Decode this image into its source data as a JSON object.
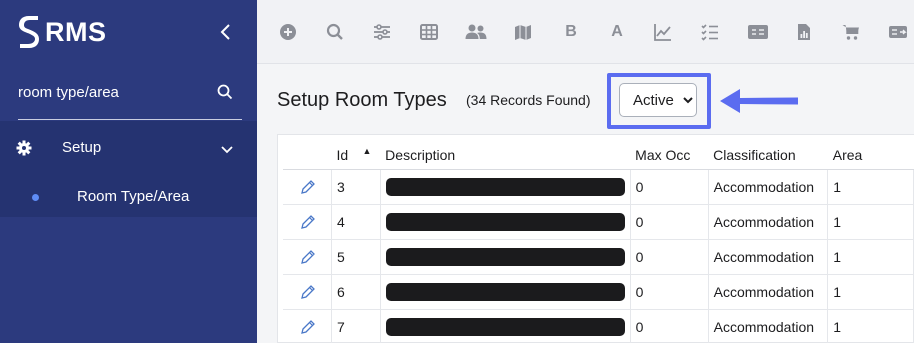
{
  "app": {
    "logo_text": "RMS"
  },
  "sidebar": {
    "search": {
      "value": "room type/area",
      "placeholder": ""
    },
    "menu": {
      "label": "Setup",
      "icon": "gear-icon",
      "expanded": true,
      "items": [
        {
          "label": "Room Type/Area",
          "active": true
        }
      ]
    }
  },
  "toolbar": {
    "icons": [
      "add-circle-icon",
      "search-icon",
      "sliders-icon",
      "grid-icon",
      "people-icon",
      "map-icon",
      "bold-b-icon",
      "letter-a-icon",
      "line-chart-icon",
      "checklist-icon",
      "cash-icon",
      "report-icon",
      "cart-icon",
      "payment-card-icon"
    ],
    "b_text": "B",
    "a_text": "A"
  },
  "page": {
    "title": "Setup Room Types",
    "record_count": "(34 Records Found)",
    "status_filter": {
      "selected": "Active",
      "options": [
        "Active"
      ]
    },
    "annotation_color": "#5b6cf0"
  },
  "table": {
    "columns": {
      "id": "Id",
      "description": "Description",
      "max_occ": "Max Occ",
      "classification": "Classification",
      "area": "Area"
    },
    "sort": {
      "column": "Id",
      "direction": "asc"
    },
    "rows": [
      {
        "id": "3",
        "description_redacted": true,
        "max_occ": "0",
        "classification": "Accommodation",
        "area": "1"
      },
      {
        "id": "4",
        "description_redacted": true,
        "max_occ": "0",
        "classification": "Accommodation",
        "area": "1"
      },
      {
        "id": "5",
        "description_redacted": true,
        "max_occ": "0",
        "classification": "Accommodation",
        "area": "1"
      },
      {
        "id": "6",
        "description_redacted": true,
        "max_occ": "0",
        "classification": "Accommodation",
        "area": "1"
      },
      {
        "id": "7",
        "description_redacted": true,
        "max_occ": "0",
        "classification": "Accommodation",
        "area": "1"
      }
    ]
  },
  "colors": {
    "sidebar_bg": "#2c3a7e",
    "sidebar_active_bg": "#253371",
    "accent": "#5b6cf0",
    "dot": "#5f8cf5"
  }
}
